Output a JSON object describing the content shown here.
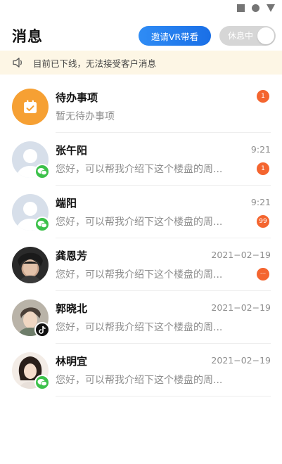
{
  "header": {
    "title": "消息",
    "invite_label": "邀请VR带看",
    "rest_label": "休息中"
  },
  "notice": {
    "text": "目前已下线，无法接受客户消息",
    "icon": "speaker-icon"
  },
  "todo": {
    "title": "待办事项",
    "subtitle": "暂无待办事项",
    "count": "1",
    "icon": "calendar-check-icon"
  },
  "conversations": [
    {
      "name": "张午阳",
      "preview": "您好，可以帮我介绍下这个楼盘的周...",
      "time": "9:21",
      "count": "1",
      "app": "wechat"
    },
    {
      "name": "端阳",
      "preview": "您好，可以帮我介绍下这个楼盘的周...",
      "time": "9:21",
      "count": "99",
      "app": "wechat"
    },
    {
      "name": "龚恩芳",
      "preview": "您好，可以帮我介绍下这个楼盘的周...",
      "time": "2021−02−19",
      "count": "···",
      "app": "none"
    },
    {
      "name": "郭晓北",
      "preview": "您好，可以帮我介绍下这个楼盘的周...",
      "time": "2021−02−19",
      "count": "",
      "app": "tiktok"
    },
    {
      "name": "林明宜",
      "preview": "您好，可以帮我介绍下这个楼盘的周...",
      "time": "2021−02−19",
      "count": "",
      "app": "wechat"
    }
  ],
  "colors": {
    "accent": "#2f8cf5",
    "badge": "#f4652f",
    "notice_bg": "#fdf6e5",
    "todo_icon_bg": "#f6a033",
    "wechat": "#3cc14a"
  }
}
